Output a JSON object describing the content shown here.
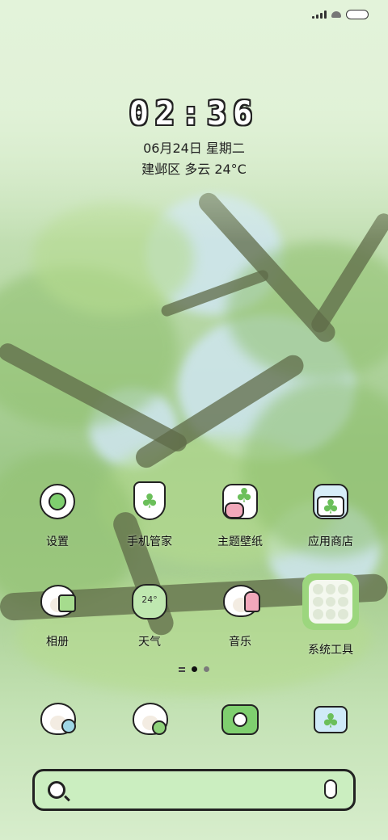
{
  "status_bar": {
    "signal_icon": "signal-icon",
    "wifi_icon": "wifi-icon",
    "battery_icon": "battery-icon"
  },
  "lockscreen": {
    "clock": "02:36",
    "date": "06月24日 星期二",
    "weather": "建邺区 多云 24°C"
  },
  "apps_row1": [
    {
      "label": "设置",
      "icon": "settings-icon"
    },
    {
      "label": "手机管家",
      "icon": "shield-icon"
    },
    {
      "label": "主题壁纸",
      "icon": "theme-icon"
    },
    {
      "label": "应用商店",
      "icon": "store-icon"
    }
  ],
  "apps_row2": [
    {
      "label": "相册",
      "icon": "gallery-icon"
    },
    {
      "label": "天气",
      "icon": "weather-icon",
      "badge": "24°"
    },
    {
      "label": "音乐",
      "icon": "music-icon"
    },
    {
      "label": "系统工具",
      "icon": "folder-icon"
    }
  ],
  "dock": [
    {
      "icon": "phone-icon"
    },
    {
      "icon": "messages-icon"
    },
    {
      "icon": "camera-icon"
    },
    {
      "icon": "mail-icon"
    }
  ],
  "pager": {
    "pages": 2,
    "current": 1
  },
  "search_bar": {
    "search_icon": "search-icon",
    "voice_icon": "voice-icon"
  }
}
